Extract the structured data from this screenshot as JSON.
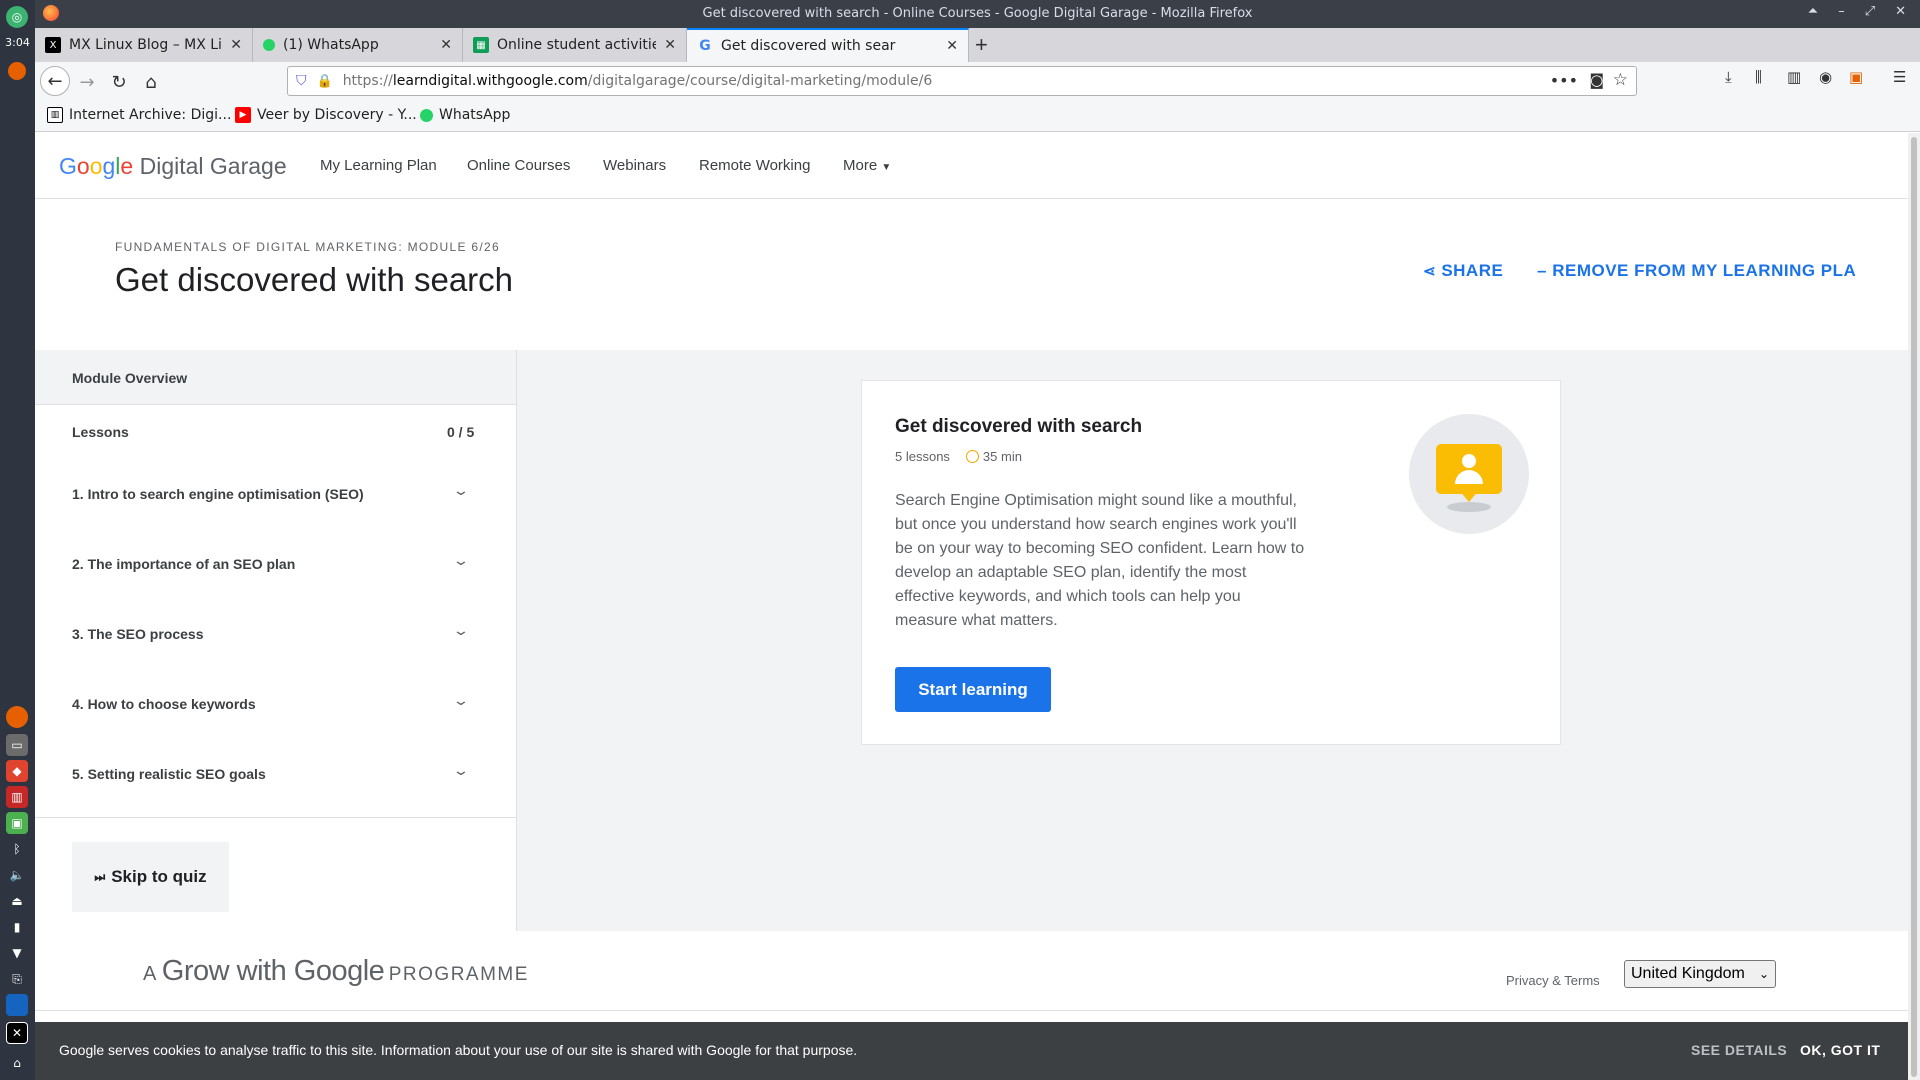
{
  "system": {
    "clock": "3:04"
  },
  "window": {
    "title": "Get discovered with search - Online Courses - Google Digital Garage - Mozilla Firefox",
    "controls": [
      "⏶",
      "–",
      "⤢",
      "✕"
    ]
  },
  "tabs": [
    {
      "label": "MX Linux Blog – MX Linu",
      "active": false
    },
    {
      "label": "(1) WhatsApp",
      "active": false
    },
    {
      "label": "Online student activities",
      "active": false
    },
    {
      "label": "Get discovered with sear",
      "active": true
    }
  ],
  "urlbar": {
    "scheme": "https://",
    "host": "learndigital.withgoogle.com",
    "path": "/digitalgarage/course/digital-marketing/module/6"
  },
  "bookmarks": [
    {
      "label": "Internet Archive: Digi..."
    },
    {
      "label": "Veer by Discovery - Y..."
    },
    {
      "label": "WhatsApp"
    }
  ],
  "site": {
    "logo_google": "Google",
    "logo_suffix": "Digital Garage",
    "nav": [
      "My Learning Plan",
      "Online Courses",
      "Webinars",
      "Remote Working",
      "More"
    ]
  },
  "module": {
    "eyebrow": "FUNDAMENTALS OF DIGITAL MARKETING: MODULE 6/26",
    "title": "Get discovered with search",
    "share_label": "SHARE",
    "remove_label": "REMOVE FROM MY LEARNING PLA"
  },
  "sidebar": {
    "overview_label": "Module Overview",
    "lessons_label": "Lessons",
    "lessons_count": "0 / 5",
    "lessons": [
      "1. Intro to search engine optimisation (SEO)",
      "2. The importance of an SEO plan",
      "3. The SEO process",
      "4. How to choose keywords",
      "5. Setting realistic SEO goals"
    ],
    "skip_quiz_label": "Skip to quiz"
  },
  "card": {
    "title": "Get discovered with search",
    "lessons": "5 lessons",
    "duration": "35 min",
    "description": "Search Engine Optimisation might sound like a mouthful, but once you understand how search engines work you'll be on your way to becoming SEO confident. Learn how to develop an adaptable SEO plan, identify the most effective keywords, and which tools can help you measure what matters.",
    "cta_label": "Start learning"
  },
  "footer": {
    "grow_prefix": "A",
    "grow_main": "Grow with Google",
    "grow_suffix": "PROGRAMME",
    "privacy_label": "Privacy & Terms",
    "country_selected": "United Kingdom"
  },
  "cookie": {
    "text": "Google serves cookies to analyse traffic to this site. Information about your use of our site is shared with Google for that purpose.",
    "details_label": "SEE DETAILS",
    "ok_label": "OK, GOT IT"
  },
  "colors": {
    "accent": "#1a73e8",
    "firefox_tab_accent": "#0a84ff",
    "cookie_bg": "#3c4043",
    "illustration_yellow": "#fbbc04"
  }
}
